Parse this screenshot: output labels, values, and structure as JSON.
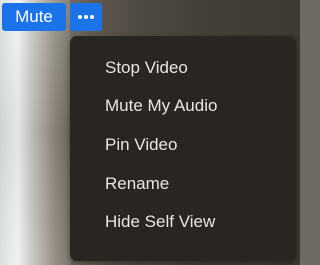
{
  "toolbar": {
    "mute_label": "Mute",
    "more_icon": "ellipsis-icon"
  },
  "menu": {
    "items": [
      {
        "label": "Stop Video"
      },
      {
        "label": "Mute My Audio"
      },
      {
        "label": "Pin Video"
      },
      {
        "label": "Rename"
      },
      {
        "label": "Hide Self View"
      }
    ]
  },
  "colors": {
    "accent": "#1a73e8",
    "menu_bg": "#292622",
    "menu_text": "#e9e6e2"
  }
}
